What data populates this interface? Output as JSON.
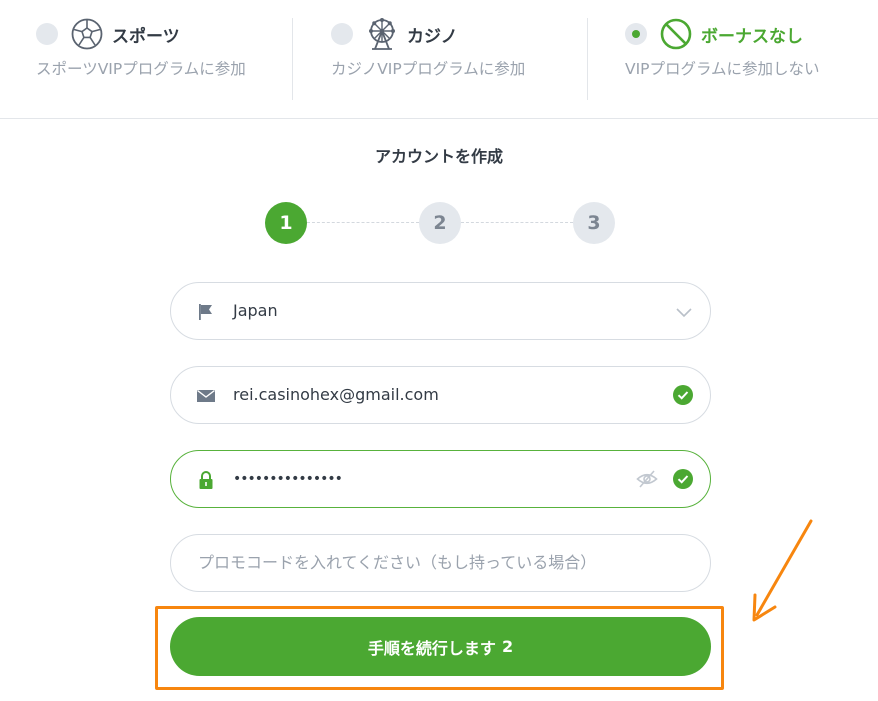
{
  "bonus_options": [
    {
      "title": "スポーツ",
      "desc": "スポーツVIPプログラムに参加",
      "selected": false,
      "icon": "soccer-ball-icon"
    },
    {
      "title": "カジノ",
      "desc": "カジノVIPプログラムに参加",
      "selected": false,
      "icon": "ferris-wheel-icon"
    },
    {
      "title": "ボーナスなし",
      "desc": "VIPプログラムに参加しない",
      "selected": true,
      "icon": "no-bonus-icon"
    }
  ],
  "form": {
    "title": "アカウントを作成",
    "steps": [
      "1",
      "2",
      "3"
    ],
    "active_step": 1,
    "country": {
      "value": "Japan",
      "icon": "flag-icon"
    },
    "email": {
      "value": "rei.casinohex@gmail.com",
      "icon": "envelope-icon",
      "valid": true
    },
    "password": {
      "value": "•••••••••••••••",
      "icon": "lock-icon",
      "valid": true
    },
    "promo": {
      "placeholder": "プロモコードを入れてください（もし持っている場合）",
      "value": ""
    },
    "submit": {
      "label": "手順を続行します",
      "step": "2"
    }
  },
  "colors": {
    "brand_green": "#4ba832",
    "highlight_orange": "#f7860f",
    "muted": "#9aa2ad"
  }
}
